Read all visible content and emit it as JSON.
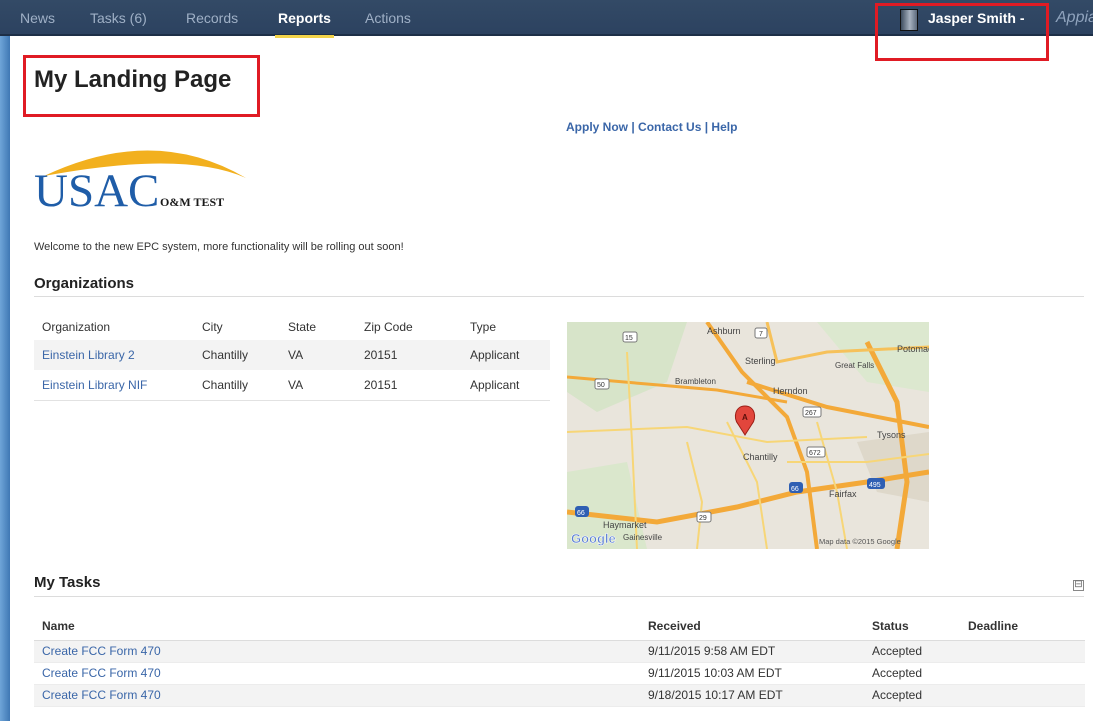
{
  "nav": {
    "tabs": [
      {
        "label": "News"
      },
      {
        "label": "Tasks (6)"
      },
      {
        "label": "Records"
      },
      {
        "label": "Reports"
      },
      {
        "label": "Actions"
      }
    ],
    "user_name": "Jasper Smith -",
    "app_name": "Appia"
  },
  "page": {
    "title": "My Landing Page",
    "links": {
      "apply": "Apply Now",
      "contact": "Contact Us",
      "help": "Help",
      "sep": " | "
    },
    "logo": {
      "main": "USAC",
      "sub": "O&M TEST"
    },
    "welcome": "Welcome to the new EPC system, more functionality will be rolling out soon!"
  },
  "organizations": {
    "title": "Organizations",
    "columns": [
      "Organization",
      "City",
      "State",
      "Zip Code",
      "Type"
    ],
    "rows": [
      [
        "Einstein Library 2",
        "Chantilly",
        "VA",
        "20151",
        "Applicant"
      ],
      [
        "Einstein Library NIF",
        "Chantilly",
        "VA",
        "20151",
        "Applicant"
      ]
    ]
  },
  "map": {
    "labels": {
      "ashburn": "Ashburn",
      "sterling": "Sterling",
      "potomac": "Potomac",
      "great_falls": "Great Falls",
      "brambleton": "Brambleton",
      "herndon": "Herndon",
      "tysons": "Tysons",
      "chantilly": "Chantilly",
      "fairfax": "Fairfax",
      "haymarket": "Haymarket",
      "gainesville": "Gainesville",
      "marker": "A",
      "attribution": "Map data ©2015 Google",
      "brand": "Google",
      "r15": "15",
      "r7": "7",
      "r50": "50",
      "r267": "267",
      "r672": "672",
      "r66": "66",
      "r29": "29",
      "r495": "495"
    }
  },
  "tasks": {
    "title": "My Tasks",
    "collapse_glyph": "⊟",
    "columns": [
      "Name",
      "Received",
      "Status",
      "Deadline"
    ],
    "rows": [
      [
        "Create FCC Form 470",
        "9/11/2015 9:58 AM EDT",
        "Accepted",
        ""
      ],
      [
        "Create FCC Form 470",
        "9/11/2015 10:03 AM EDT",
        "Accepted",
        ""
      ],
      [
        "Create FCC Form 470",
        "9/18/2015 10:17 AM EDT",
        "Accepted",
        ""
      ]
    ]
  },
  "colors": {
    "nav_bg": "#2c4260",
    "link": "#3a66a8",
    "highlight": "#e01b24",
    "active_tab_underline": "#f2d349"
  }
}
